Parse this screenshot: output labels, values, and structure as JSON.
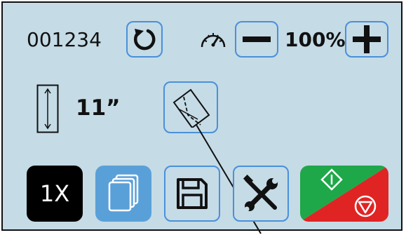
{
  "counter": {
    "value": "001234"
  },
  "zoom": {
    "value": "100%"
  },
  "paper": {
    "length": "11”"
  },
  "copies": {
    "label": "1X"
  },
  "icons": {
    "reset": "reset-counter-icon",
    "speed": "speedometer-icon",
    "zoom_out": "minus-icon",
    "zoom_in": "plus-icon",
    "paper_length": "paper-length-icon",
    "fold": "fold-icon",
    "pages": "pages-icon",
    "save": "save-icon",
    "tools": "tools-icon",
    "start": "start-icon",
    "stop": "stop-icon"
  },
  "colors": {
    "panel": "#c5dbe6",
    "button_border": "#4a90d9",
    "start": "#1fa84a",
    "stop": "#e02424",
    "copies_bg": "#000000",
    "pages_bg": "#5aa0d8"
  }
}
